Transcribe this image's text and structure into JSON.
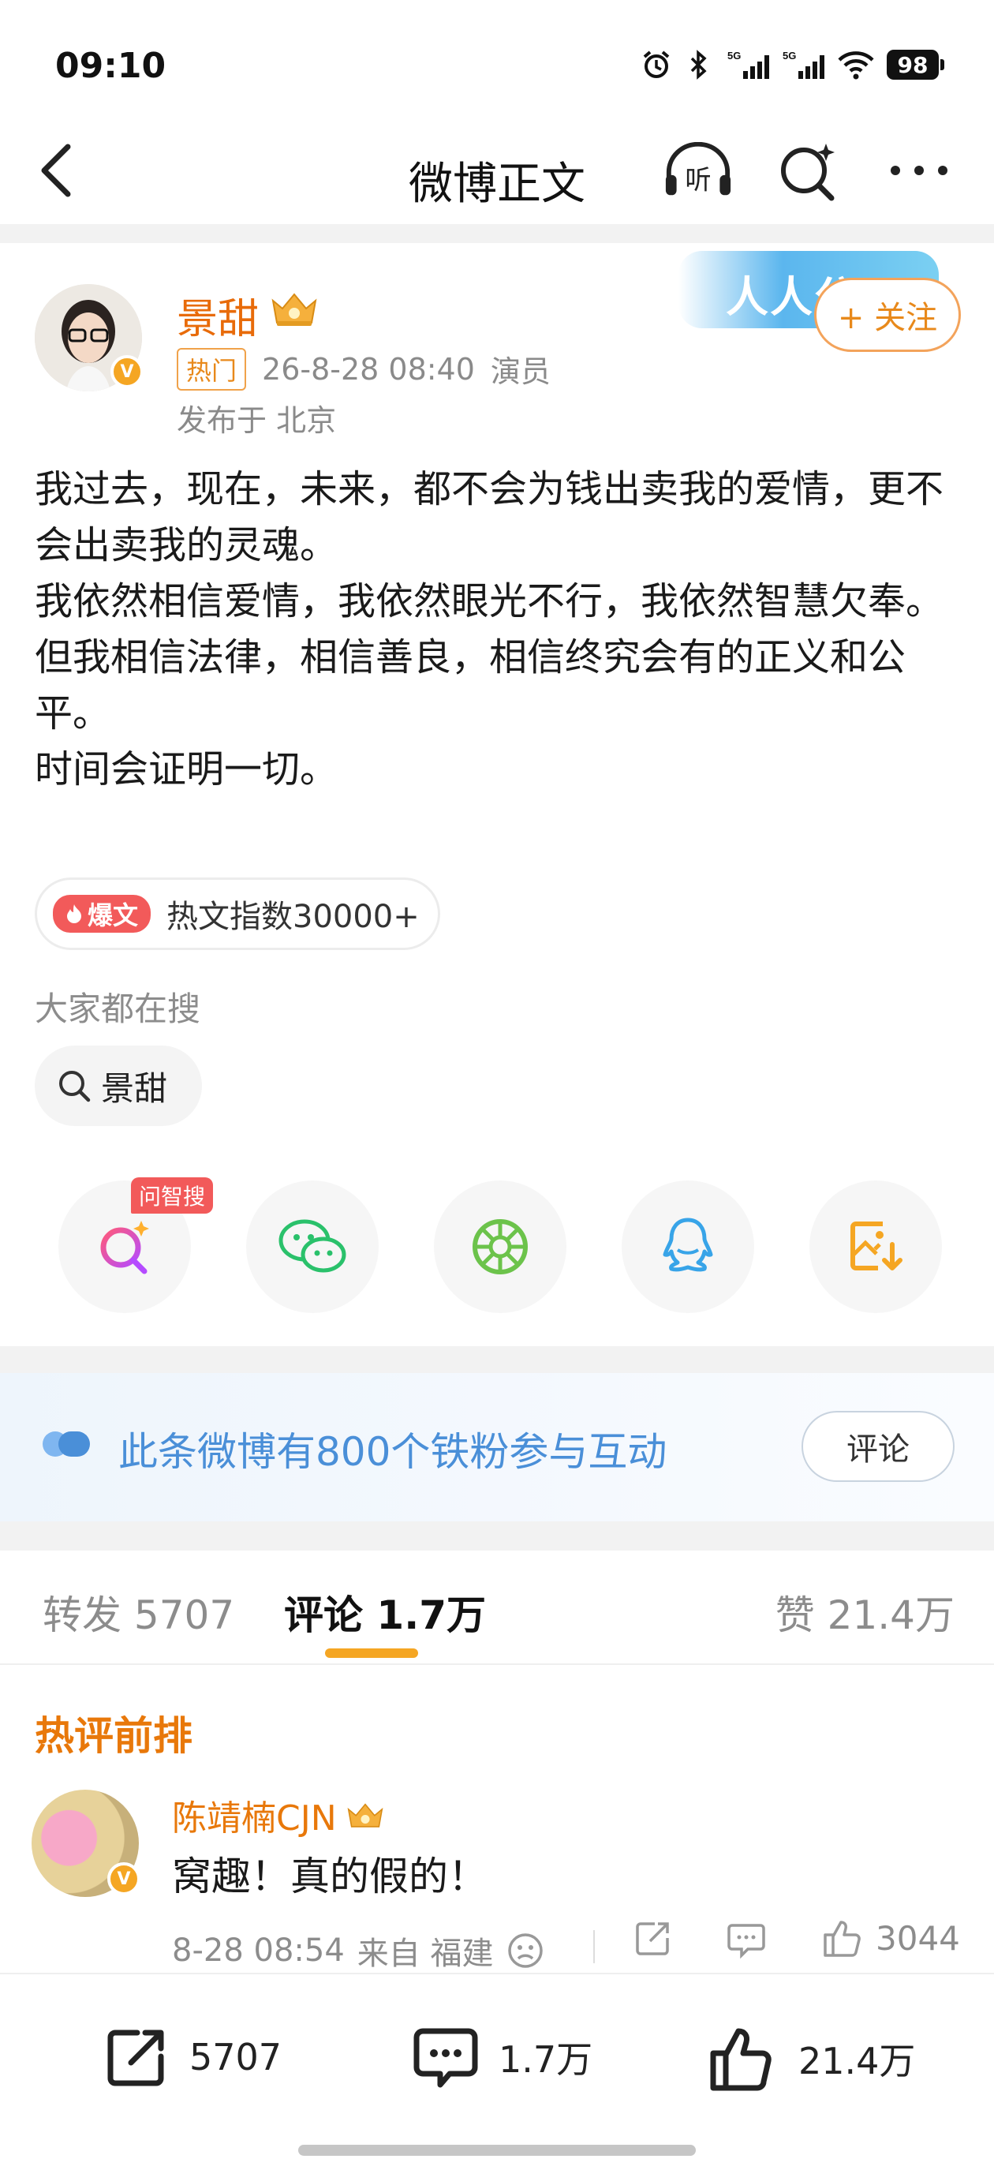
{
  "status_bar": {
    "time": "09:10",
    "battery": "98",
    "signal_1": "5G",
    "signal_2": "5G"
  },
  "nav": {
    "title": "微博正文",
    "icons": [
      "back-icon",
      "headphones-listen-icon",
      "search-sparkle-icon",
      "more-icon"
    ],
    "listen_label": "听"
  },
  "post": {
    "author": "景甜",
    "hot_tag": "热门",
    "time": "26-8-28 08:40",
    "source": "演员",
    "location": "发布于 北京",
    "banner_text": "人人公",
    "follow_label": "+ 关注",
    "paragraphs": [
      "我过去，现在，未来，都不会为钱出卖我的爱情，更不会出卖我的灵魂。",
      "我依然相信爱情，我依然眼光不行，我依然智慧欠奉。",
      "但我相信法律，相信善良，相信终究会有的正义和公平。",
      "时间会证明一切。"
    ],
    "baowen_label": "爆文",
    "hot_index": "热文指数30000+"
  },
  "search": {
    "title": "大家都在搜",
    "chip": "景甜"
  },
  "share": {
    "zhisou_badge": "问智搜",
    "buttons": [
      "ai-search-icon",
      "wechat-icon",
      "moments-icon",
      "qq-icon",
      "save-image-icon"
    ]
  },
  "fan_banner": {
    "text": "此条微博有800个铁粉参与互动",
    "button": "评论"
  },
  "tabs": {
    "repost": "转发 5707",
    "comment": "评论 1.7万",
    "like": "赞 21.4万"
  },
  "comments": {
    "heading": "热评前排",
    "items": [
      {
        "name": "陈靖楠CJN",
        "text": "窝趣！真的假的！",
        "time": "8-28 08:54",
        "from": "来自 福建",
        "likes": "3044"
      }
    ]
  },
  "bottom_bar": {
    "repost": "5707",
    "comment": "1.7万",
    "like": "21.4万"
  },
  "colors": {
    "accent_orange": "#e8891b",
    "link_blue": "#4a8fd8",
    "hot_red": "#f25a5a"
  }
}
